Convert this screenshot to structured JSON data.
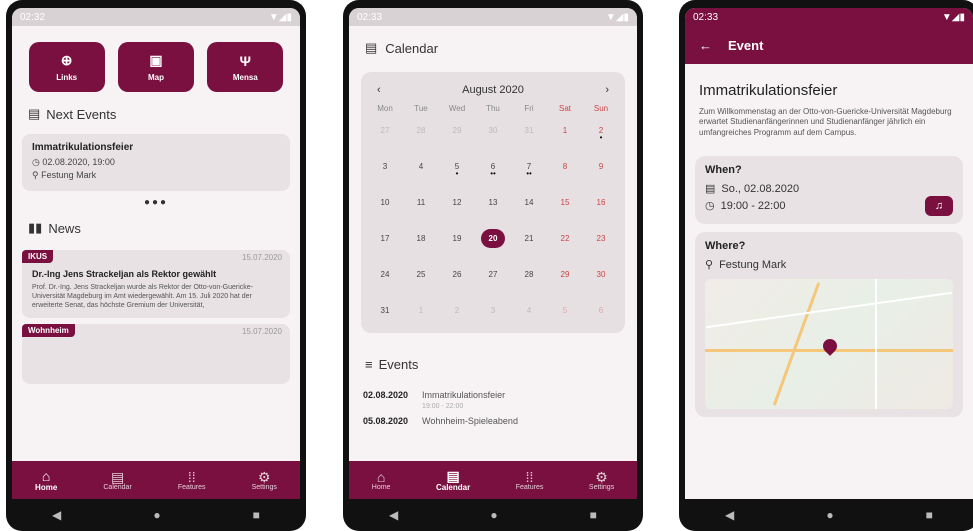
{
  "phones": [
    {
      "status_time": "02:32",
      "tiles": [
        {
          "label": "Links",
          "icon": "globe-icon"
        },
        {
          "label": "Map",
          "icon": "map-icon"
        },
        {
          "label": "Mensa",
          "icon": "cutlery-icon"
        }
      ],
      "next_events_title": "Next Events",
      "next_event": {
        "title": "Immatrikulationsfeier",
        "datetime": "02.08.2020, 19:00",
        "location": "Festung Mark"
      },
      "news_title": "News",
      "news": [
        {
          "badge": "IKUS",
          "date": "15.07.2020",
          "title": "Dr.-Ing Jens Strackeljan als Rektor gewählt",
          "text": "Prof. Dr.-Ing. Jens Strackeljan wurde als Rektor der Otto-von-Guericke-Universität Magdeburg im Amt wiedergewählt. Am 15. Juli 2020 hat der erweiterte Senat, das höchste Gremium der Universität,"
        },
        {
          "badge": "Wohnheim",
          "date": "15.07.2020"
        }
      ],
      "nav": [
        "Home",
        "Calendar",
        "Features",
        "Settings"
      ]
    },
    {
      "status_time": "02:33",
      "calendar_title": "Calendar",
      "month": "August 2020",
      "weekdays": [
        "Mon",
        "Tue",
        "Wed",
        "Thu",
        "Fri",
        "Sat",
        "Sun"
      ],
      "days": [
        {
          "n": "27",
          "o": true
        },
        {
          "n": "28",
          "o": true
        },
        {
          "n": "29",
          "o": true
        },
        {
          "n": "30",
          "o": true
        },
        {
          "n": "31",
          "o": true
        },
        {
          "n": "1"
        },
        {
          "n": "2",
          "m": "•"
        },
        {
          "n": "3"
        },
        {
          "n": "4"
        },
        {
          "n": "5",
          "m": "•"
        },
        {
          "n": "6",
          "m": "••"
        },
        {
          "n": "7",
          "m": "••"
        },
        {
          "n": "8"
        },
        {
          "n": "9"
        },
        {
          "n": "10"
        },
        {
          "n": "11"
        },
        {
          "n": "12"
        },
        {
          "n": "13"
        },
        {
          "n": "14"
        },
        {
          "n": "15"
        },
        {
          "n": "16"
        },
        {
          "n": "17"
        },
        {
          "n": "18"
        },
        {
          "n": "19"
        },
        {
          "n": "20",
          "sel": true
        },
        {
          "n": "21"
        },
        {
          "n": "22"
        },
        {
          "n": "23"
        },
        {
          "n": "24"
        },
        {
          "n": "25"
        },
        {
          "n": "26"
        },
        {
          "n": "27"
        },
        {
          "n": "28"
        },
        {
          "n": "29"
        },
        {
          "n": "30"
        },
        {
          "n": "31"
        },
        {
          "n": "1",
          "o": true
        },
        {
          "n": "2",
          "o": true
        },
        {
          "n": "3",
          "o": true
        },
        {
          "n": "4",
          "o": true
        },
        {
          "n": "5",
          "o": true
        },
        {
          "n": "6",
          "o": true
        }
      ],
      "events_title": "Events",
      "events": [
        {
          "date": "02.08.2020",
          "title": "Immatrikulationsfeier",
          "time": "19:00 - 22:00"
        },
        {
          "date": "05.08.2020",
          "title": "Wohnheim-Spieleabend",
          "time": ""
        }
      ],
      "nav": [
        "Home",
        "Calendar",
        "Features",
        "Settings"
      ]
    },
    {
      "status_time": "02:33",
      "appbar_title": "Event",
      "event_title": "Immatrikulationsfeier",
      "event_desc": "Zum Willkommenstag an der Otto-von-Guericke-Universität Magdeburg erwartet Studienanfängerinnen und Studienanfänger jährlich ein umfangreiches Programm auf dem Campus.",
      "when_label": "When?",
      "when_date": "So., 02.08.2020",
      "when_time": "19:00 - 22:00",
      "where_label": "Where?",
      "where_place": "Festung Mark"
    }
  ],
  "colors": {
    "primary": "#7a1040",
    "card": "#e8e2e5"
  }
}
